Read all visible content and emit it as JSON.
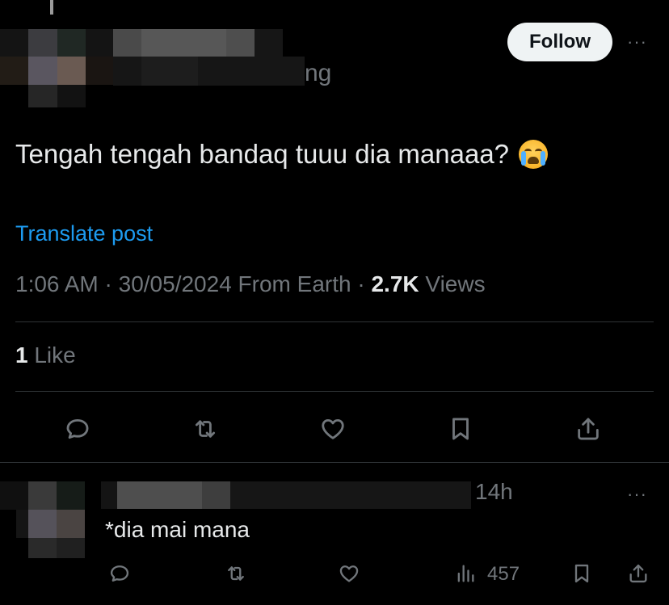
{
  "header": {
    "follow_label": "Follow",
    "more_label": "···",
    "handle_tail": "ng"
  },
  "tweet": {
    "text": "Tengah tengah bandaq tuuu dia manaaa?",
    "emoji_icon": "loudly-crying-face-emoji",
    "translate_label": "Translate post",
    "time": "1:06 AM",
    "date": "30/05/2024",
    "source": "From Earth",
    "views_count": "2.7K",
    "views_label": "Views",
    "like_count": "1",
    "like_label": "Like"
  },
  "actions": [
    "reply-icon",
    "retweet-icon",
    "heart-icon",
    "bookmark-icon",
    "share-icon"
  ],
  "reply": {
    "time": "14h",
    "more_label": "···",
    "text": "*dia mai mana",
    "views_count": "457"
  },
  "colors": {
    "background": "#000000",
    "text": "#e7e9ea",
    "muted": "#71767b",
    "link": "#1d9bf0",
    "divider": "#2f3336"
  }
}
